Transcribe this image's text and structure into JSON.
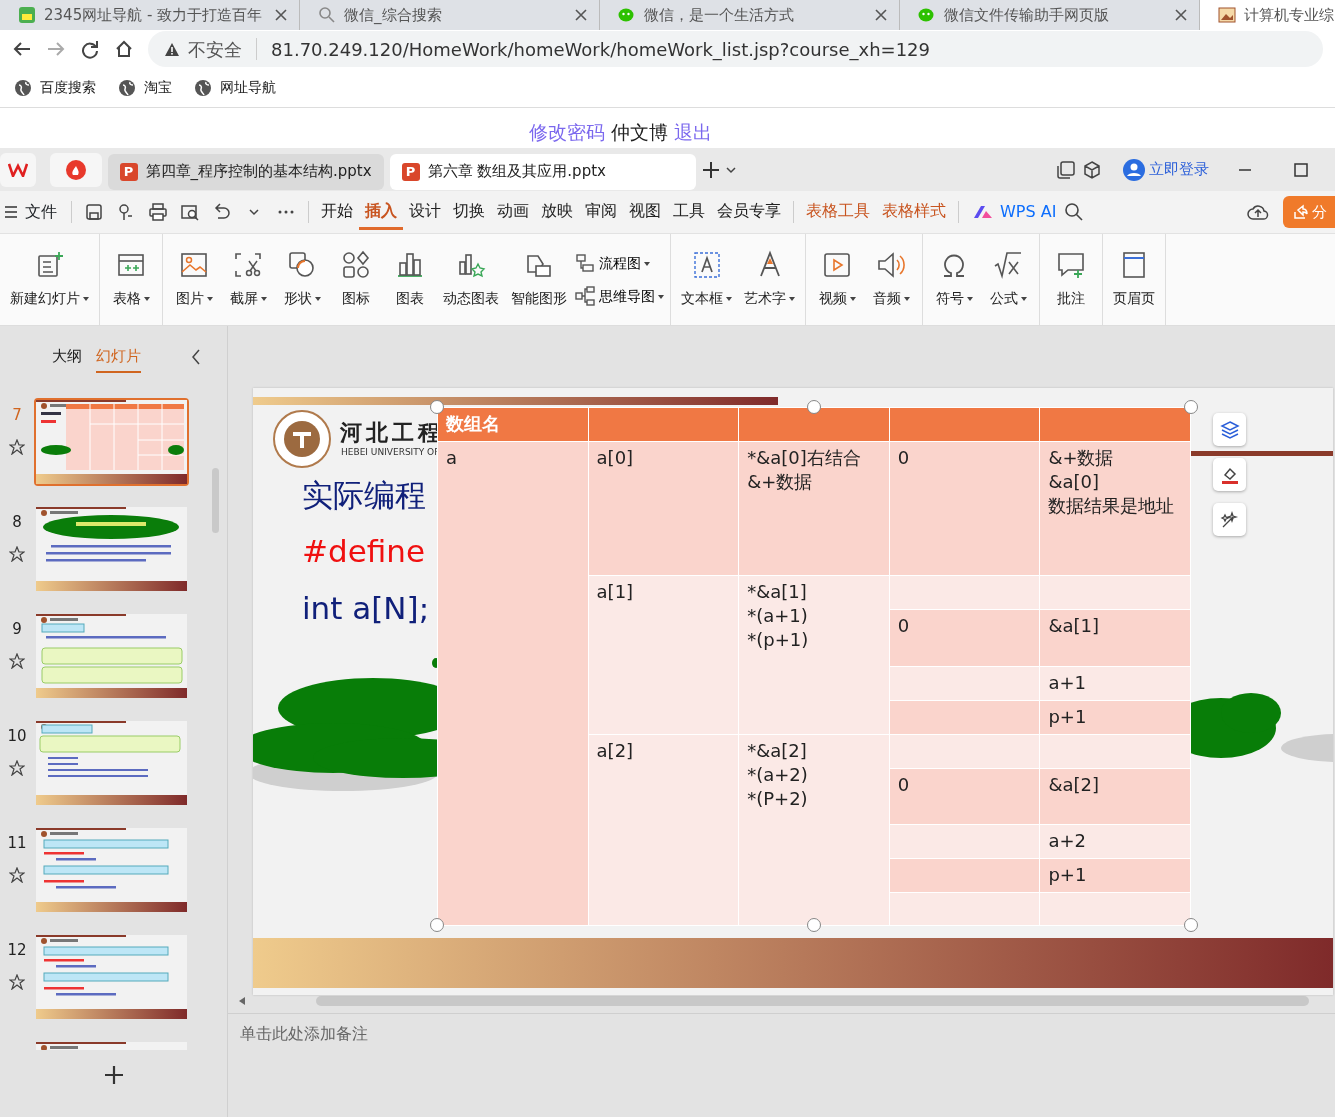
{
  "browser": {
    "tabs": [
      {
        "title": "2345网址导航 - 致力于打造百年",
        "kind": "portal",
        "selected": false
      },
      {
        "title": "微信_综合搜索",
        "kind": "search",
        "selected": false
      },
      {
        "title": "微信，是一个生活方式",
        "kind": "wechat",
        "selected": false
      },
      {
        "title": "微信文件传输助手网页版",
        "kind": "wechat",
        "selected": false
      },
      {
        "title": "计算机专业综",
        "kind": "image",
        "selected": true
      }
    ],
    "security": "不安全",
    "url": "81.70.249.120/HomeWork/homeWork/homeWork_list.jsp?course_xh=129",
    "bookmarks": [
      "百度搜索",
      "淘宝",
      "网址导航"
    ]
  },
  "page_links": [
    {
      "text": "修改密码",
      "kind": "link"
    },
    {
      "text": "仲文博",
      "kind": "text"
    },
    {
      "text": "退出",
      "kind": "link"
    }
  ],
  "wps": {
    "doc_tabs": [
      {
        "title": "第四章_程序控制的基本结构.pptx",
        "badge": "P",
        "selected": false
      },
      {
        "title": "第六章 数组及其应用.pptx",
        "badge": "P",
        "selected": true
      }
    ],
    "login": "立即登录",
    "file_menu": "文件",
    "menu_tabs": [
      {
        "label": "开始",
        "kind": "main",
        "selected": false
      },
      {
        "label": "插入",
        "kind": "main",
        "selected": true
      },
      {
        "label": "设计",
        "kind": "main",
        "selected": false
      },
      {
        "label": "切换",
        "kind": "main",
        "selected": false
      },
      {
        "label": "动画",
        "kind": "main",
        "selected": false
      },
      {
        "label": "放映",
        "kind": "main",
        "selected": false
      },
      {
        "label": "审阅",
        "kind": "main",
        "selected": false
      },
      {
        "label": "视图",
        "kind": "main",
        "selected": false
      },
      {
        "label": "工具",
        "kind": "main",
        "selected": false
      },
      {
        "label": "会员专享",
        "kind": "main",
        "selected": false
      },
      {
        "label": "表格工具",
        "kind": "contextual",
        "selected": false
      },
      {
        "label": "表格样式",
        "kind": "contextual",
        "selected": false
      }
    ],
    "ai_label": "WPS AI",
    "share_label": "分",
    "ribbon": [
      {
        "items": [
          {
            "kind": "large",
            "label": "新建幻灯片",
            "dropdown": true
          }
        ]
      },
      {
        "items": [
          {
            "kind": "large",
            "label": "表格",
            "dropdown": true
          }
        ]
      },
      {
        "items": [
          {
            "kind": "large",
            "label": "图片",
            "dropdown": true
          },
          {
            "kind": "large",
            "label": "截屏",
            "dropdown": true
          },
          {
            "kind": "large",
            "label": "形状",
            "dropdown": true
          },
          {
            "kind": "large",
            "label": "图标",
            "dropdown": false
          },
          {
            "kind": "large",
            "label": "图表",
            "dropdown": false
          },
          {
            "kind": "large",
            "label": "动态图表",
            "dropdown": false
          },
          {
            "kind": "large",
            "label": "智能图形",
            "dropdown": false
          },
          {
            "kind": "small",
            "label": "流程图",
            "dropdown": true
          },
          {
            "kind": "small",
            "label": "思维导图",
            "dropdown": true
          }
        ]
      },
      {
        "items": [
          {
            "kind": "large",
            "label": "文本框",
            "dropdown": true
          },
          {
            "kind": "large",
            "label": "艺术字",
            "dropdown": true
          }
        ]
      },
      {
        "items": [
          {
            "kind": "large",
            "label": "视频",
            "dropdown": true
          },
          {
            "kind": "large",
            "label": "音频",
            "dropdown": true
          }
        ]
      },
      {
        "items": [
          {
            "kind": "large",
            "label": "符号",
            "dropdown": true
          },
          {
            "kind": "large",
            "label": "公式",
            "dropdown": true
          }
        ]
      },
      {
        "items": [
          {
            "kind": "large",
            "label": "批注",
            "dropdown": false
          }
        ]
      },
      {
        "items": [
          {
            "kind": "large",
            "label": "页眉页",
            "dropdown": false
          }
        ]
      }
    ]
  },
  "panel": {
    "tabs": [
      {
        "label": "大纲",
        "selected": false
      },
      {
        "label": "幻灯片",
        "selected": true
      }
    ],
    "slides": [
      {
        "number": "7",
        "kind": "table",
        "selected": true
      },
      {
        "number": "8",
        "kind": "cloud",
        "selected": false
      },
      {
        "number": "9",
        "kind": "notes",
        "selected": false
      },
      {
        "number": "10",
        "kind": "code",
        "selected": false
      },
      {
        "number": "11",
        "kind": "steps",
        "selected": false
      },
      {
        "number": "12",
        "kind": "steps",
        "selected": false
      },
      {
        "kind": "steps",
        "selected": false
      }
    ]
  },
  "slide": {
    "school_name": "河北工程",
    "school_name_en": "HEBEI UNIVERSITY OF",
    "lines": [
      {
        "text": "实际编程",
        "kind": "heading"
      },
      {
        "text": "#define",
        "kind": "macro"
      },
      {
        "text": "int a[N];",
        "kind": "code"
      }
    ],
    "table": {
      "header": [
        "数组名"
      ],
      "arrays": [
        {
          "name": "a",
          "elements": [
            {
              "element": "a[0]",
              "forms": [
                "*&a[0]右结合",
                "&+数据"
              ],
              "rows": [
                {
                  "column_4": "0",
                  "column_5": [
                    "&+数据",
                    "&a[0]",
                    "数据结果是地址"
                  ]
                }
              ]
            },
            {
              "element": "a[1]",
              "forms": [
                "*&a[1]",
                "*(a+1)",
                "*(p+1)"
              ],
              "rows": [
                {},
                {
                  "column_4": "0",
                  "column_5": [
                    "&a[1]"
                  ]
                },
                {
                  "column_5": [
                    "a+1"
                  ]
                },
                {
                  "column_5": [
                    "p+1"
                  ]
                }
              ]
            },
            {
              "element": "a[2]",
              "forms": [
                "*&a[2]",
                "*(a+2)",
                "*(P+2)"
              ],
              "rows": [
                {},
                {
                  "column_4": "0",
                  "column_5": [
                    "&a[2]"
                  ]
                },
                {
                  "column_5": [
                    "a+2"
                  ]
                },
                {
                  "column_5": [
                    "p+1"
                  ]
                },
                {}
              ]
            }
          ]
        }
      ]
    }
  },
  "notes_placeholder": "单击此处添加备注"
}
